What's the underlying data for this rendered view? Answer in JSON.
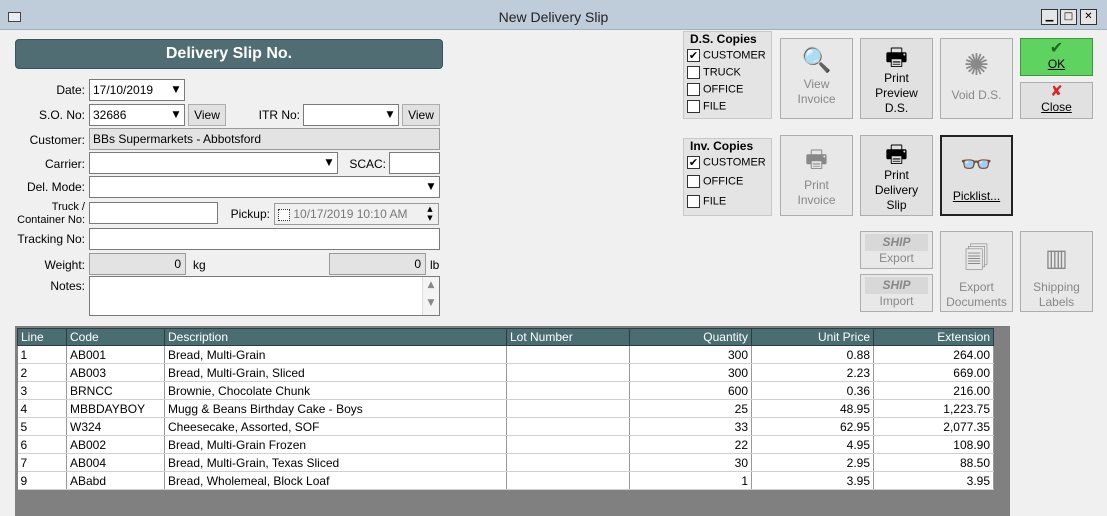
{
  "window": {
    "title": "New Delivery Slip"
  },
  "header": {
    "title": "Delivery Slip No."
  },
  "form": {
    "date_label": "Date:",
    "date_value": "17/10/2019",
    "so_label": "S.O. No:",
    "so_value": "32686",
    "so_view": "View",
    "itr_label": "ITR No:",
    "itr_value": "",
    "itr_view": "View",
    "customer_label": "Customer:",
    "customer_value": "BBs Supermarkets - Abbotsford",
    "carrier_label": "Carrier:",
    "carrier_value": "",
    "scac_label": "SCAC:",
    "scac_value": "",
    "delmode_label": "Del. Mode:",
    "delmode_value": "",
    "truck_label_1": "Truck /",
    "truck_label_2": "Container No:",
    "truck_value": "",
    "pickup_label": "Pickup:",
    "pickup_value": "10/17/2019  10:10 AM",
    "tracking_label": "Tracking No:",
    "tracking_value": "",
    "weight_label": "Weight:",
    "weight_kg": "0",
    "kg_label": "kg",
    "weight_lb": "0",
    "lb_label": "lb",
    "notes_label": "Notes:",
    "notes_value": ""
  },
  "ds_copies": {
    "title": "D.S. Copies",
    "items": [
      {
        "label": "CUSTOMER",
        "checked": "✔"
      },
      {
        "label": "TRUCK",
        "checked": ""
      },
      {
        "label": "OFFICE",
        "checked": ""
      },
      {
        "label": "FILE",
        "checked": ""
      }
    ]
  },
  "inv_copies": {
    "title": "Inv. Copies",
    "items": [
      {
        "label": "CUSTOMER",
        "checked": "✔"
      },
      {
        "label": "OFFICE",
        "checked": ""
      },
      {
        "label": "FILE",
        "checked": ""
      }
    ]
  },
  "buttons": {
    "view_invoice_1": "View",
    "view_invoice_2": "Invoice",
    "print_preview_1": "Print",
    "print_preview_2": "Preview",
    "print_preview_3": "D.S.",
    "void_ds": "Void D.S.",
    "ok": "OK",
    "close": "Close",
    "print_invoice_1": "Print",
    "print_invoice_2": "Invoice",
    "print_delivery_1": "Print",
    "print_delivery_2": "Delivery",
    "print_delivery_3": "Slip",
    "picklist": "Picklist...",
    "ship_logo": "SHIP",
    "export": "Export",
    "import": "Import",
    "export_docs_1": "Export",
    "export_docs_2": "Documents",
    "shipping_labels_1": "Shipping",
    "shipping_labels_2": "Labels"
  },
  "table": {
    "columns": [
      "Line",
      "Code",
      "Description",
      "Lot Number",
      "Quantity",
      "Unit Price",
      "Extension"
    ],
    "rows": [
      [
        "1",
        "AB001",
        "Bread, Multi-Grain",
        "",
        "300",
        "0.88",
        "264.00"
      ],
      [
        "2",
        "AB003",
        "Bread, Multi-Grain, Sliced",
        "",
        "300",
        "2.23",
        "669.00"
      ],
      [
        "3",
        "BRNCC",
        "Brownie, Chocolate Chunk",
        "",
        "600",
        "0.36",
        "216.00"
      ],
      [
        "4",
        "MBBDAYBOY",
        "Mugg & Beans Birthday Cake - Boys",
        "",
        "25",
        "48.95",
        "1,223.75"
      ],
      [
        "5",
        "W324",
        "Cheesecake, Assorted, SOF",
        "",
        "33",
        "62.95",
        "2,077.35"
      ],
      [
        "6",
        "AB002",
        "Bread, Multi-Grain Frozen",
        "",
        "22",
        "4.95",
        "108.90"
      ],
      [
        "7",
        "AB004",
        "Bread, Multi-Grain, Texas Sliced",
        "",
        "30",
        "2.95",
        "88.50"
      ],
      [
        "9",
        "ABabd",
        "Bread, Wholemeal, Block Loaf",
        "",
        "1",
        "3.95",
        "3.95"
      ]
    ]
  }
}
